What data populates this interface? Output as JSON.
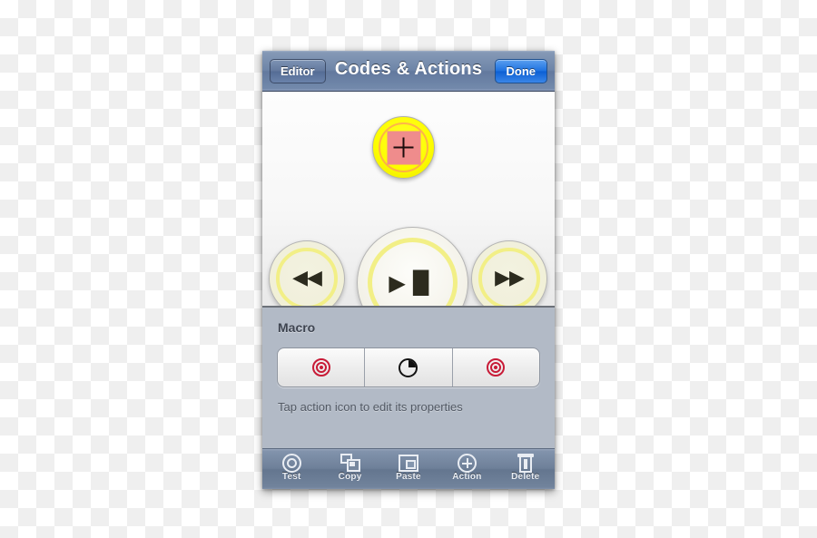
{
  "navbar": {
    "back_label": "Editor",
    "title": "Codes & Actions",
    "done_label": "Done"
  },
  "remote": {
    "buttons": [
      {
        "name": "power",
        "glyph": "+",
        "style": "yellow-red-square"
      },
      {
        "name": "rewind",
        "glyph": "◀◀"
      },
      {
        "name": "play-pause",
        "glyph": "▶▐▌"
      },
      {
        "name": "fast-forward",
        "glyph": "▶▶"
      }
    ]
  },
  "macro": {
    "section_title": "Macro",
    "actions": [
      {
        "icon": "target-icon",
        "slot": 1
      },
      {
        "icon": "clock-icon",
        "slot": 2
      },
      {
        "icon": "target-icon",
        "slot": 3
      }
    ],
    "hint": "Tap action icon to edit its properties"
  },
  "toolbar": {
    "items": [
      {
        "label": "Test",
        "icon": "target-icon"
      },
      {
        "label": "Copy",
        "icon": "copy-icon"
      },
      {
        "label": "Paste",
        "icon": "paste-icon"
      },
      {
        "label": "Action",
        "icon": "plus-circle-icon"
      },
      {
        "label": "Delete",
        "icon": "trash-icon"
      }
    ]
  },
  "colors": {
    "navbar_blue": "#6e85a8",
    "done_blue": "#1f72e0",
    "panel_gray": "#b2bac6",
    "power_yellow": "#fdfd00",
    "power_square_red": "#ef8c8c",
    "target_red": "#c81b37",
    "button_cream": "#f1f0dc",
    "button_ring_yellow": "#f2ef86"
  }
}
